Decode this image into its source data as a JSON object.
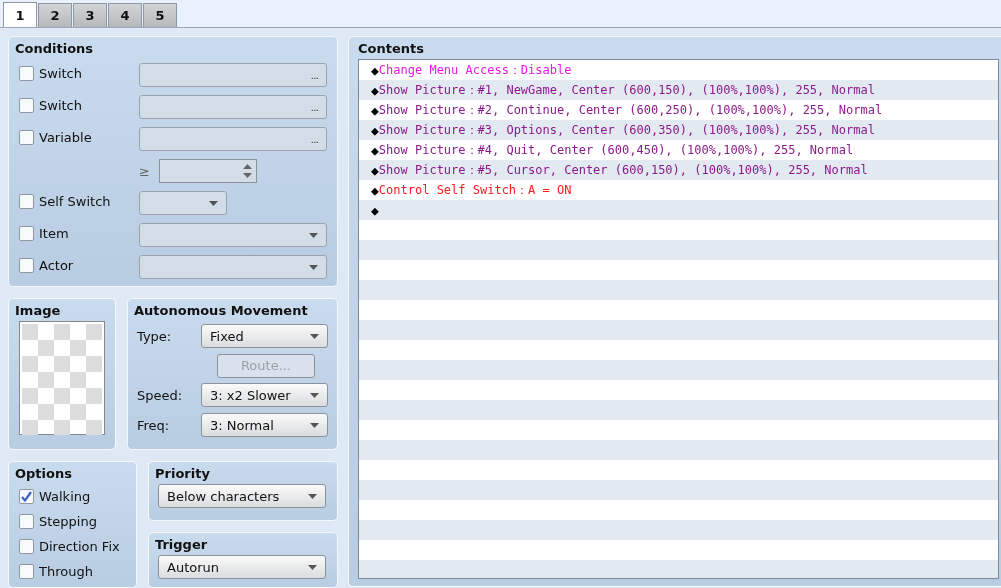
{
  "tabs": [
    {
      "label": "1",
      "selected": true
    },
    {
      "label": "2",
      "selected": false
    },
    {
      "label": "3",
      "selected": false
    },
    {
      "label": "4",
      "selected": false
    },
    {
      "label": "5",
      "selected": false
    }
  ],
  "conditions": {
    "title": "Conditions",
    "rows": [
      {
        "kind": "picker",
        "label": "Switch",
        "checked": false,
        "disabled": true,
        "button": "..."
      },
      {
        "kind": "picker",
        "label": "Switch",
        "checked": false,
        "disabled": true,
        "button": "..."
      },
      {
        "kind": "picker",
        "label": "Variable",
        "checked": false,
        "disabled": true,
        "button": "..."
      },
      {
        "kind": "compare",
        "operator": "≥",
        "disabled": true
      },
      {
        "kind": "combo_short",
        "label": "Self Switch",
        "checked": false,
        "disabled": true
      },
      {
        "kind": "combo",
        "label": "Item",
        "checked": false,
        "disabled": true
      },
      {
        "kind": "combo",
        "label": "Actor",
        "checked": false,
        "disabled": true
      }
    ]
  },
  "image": {
    "title": "Image"
  },
  "movement": {
    "title": "Autonomous Movement",
    "type_label": "Type:",
    "type_value": "Fixed",
    "route_button": {
      "label": "Route...",
      "disabled": true
    },
    "speed_label": "Speed:",
    "speed_value": "3: x2 Slower",
    "freq_label": "Freq:",
    "freq_value": "3: Normal"
  },
  "options": {
    "title": "Options",
    "items": [
      {
        "label": "Walking",
        "checked": true
      },
      {
        "label": "Stepping",
        "checked": false
      },
      {
        "label": "Direction Fix",
        "checked": false
      },
      {
        "label": "Through",
        "checked": false
      }
    ]
  },
  "priority": {
    "title": "Priority",
    "value": "Below characters"
  },
  "trigger": {
    "title": "Trigger",
    "value": "Autorun"
  },
  "contents": {
    "title": "Contents",
    "commands": [
      {
        "kind": "menu",
        "bullet": "◆",
        "text": "Change Menu Access：Disable"
      },
      {
        "kind": "picture",
        "bullet": "◆",
        "text": "Show Picture：#1, NewGame, Center (600,150), (100%,100%), 255, Normal"
      },
      {
        "kind": "picture",
        "bullet": "◆",
        "text": "Show Picture：#2, Continue, Center (600,250), (100%,100%), 255, Normal"
      },
      {
        "kind": "picture",
        "bullet": "◆",
        "text": "Show Picture：#3, Options, Center (600,350), (100%,100%), 255, Normal"
      },
      {
        "kind": "picture",
        "bullet": "◆",
        "text": "Show Picture：#4, Quit, Center (600,450), (100%,100%), 255, Normal"
      },
      {
        "kind": "picture",
        "bullet": "◆",
        "text": "Show Picture：#5, Cursor, Center (600,150), (100%,100%), 255, Normal"
      },
      {
        "kind": "switch",
        "bullet": "◆",
        "text": "Control Self Switch：A = ON"
      },
      {
        "kind": "end",
        "bullet": "◆"
      }
    ]
  }
}
